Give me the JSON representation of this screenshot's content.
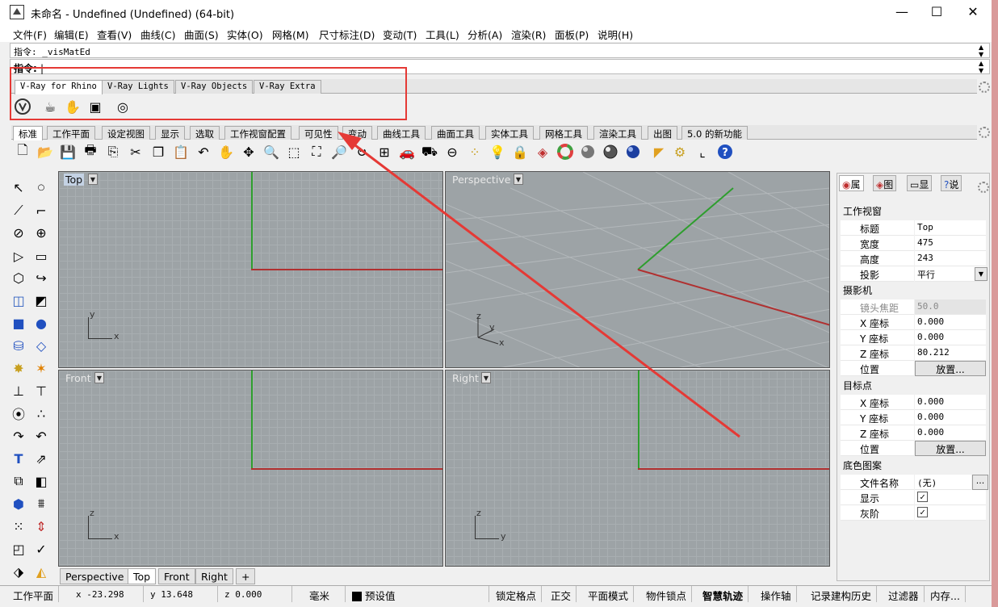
{
  "window": {
    "title": "未命名 - Undefined (Undefined) (64-bit)",
    "minimize": "—",
    "maximize": "☐",
    "close": "✕"
  },
  "menu": [
    "文件(F)",
    "编辑(E)",
    "查看(V)",
    "曲线(C)",
    "曲面(S)",
    "实体(O)",
    "网格(M)",
    "尺寸标注(D)",
    "变动(T)",
    "工具(L)",
    "分析(A)",
    "渲染(R)",
    "面板(P)",
    "说明(H)"
  ],
  "command": {
    "history": "指令: _visMatEd",
    "prompt": "指令:",
    "value": ""
  },
  "vray_tabs": [
    "V-Ray for Rhino",
    "V-Ray Lights",
    "V-Ray Objects",
    "V-Ray Extra"
  ],
  "std_tabs": [
    "标准",
    "工作平面",
    "设定视图",
    "显示",
    "选取",
    "工作视窗配置",
    "可见性",
    "变动",
    "曲线工具",
    "曲面工具",
    "实体工具",
    "网格工具",
    "渲染工具",
    "出图",
    "5.0 的新功能"
  ],
  "viewports": [
    {
      "label": "Top",
      "axis": [
        "y",
        "x"
      ]
    },
    {
      "label": "Perspective",
      "axis": [
        "z",
        "y",
        "x"
      ]
    },
    {
      "label": "Front",
      "axis": [
        "z",
        "x"
      ]
    },
    {
      "label": "Right",
      "axis": [
        "z",
        "y"
      ]
    }
  ],
  "panel": {
    "tabs": [
      "属",
      "图",
      "显",
      "说"
    ],
    "viewport_section": "工作视窗",
    "rows1": [
      [
        "标题",
        "Top"
      ],
      [
        "宽度",
        "475"
      ],
      [
        "高度",
        "243"
      ],
      [
        "投影",
        "平行"
      ]
    ],
    "camera_section": "摄影机",
    "rows2": [
      [
        "镜头焦距",
        "50.0"
      ],
      [
        "X 座标",
        "0.000"
      ],
      [
        "Y 座标",
        "0.000"
      ],
      [
        "Z 座标",
        "80.212"
      ],
      [
        "位置",
        "放置..."
      ]
    ],
    "target_section": "目标点",
    "rows3": [
      [
        "X 座标",
        "0.000"
      ],
      [
        "Y 座标",
        "0.000"
      ],
      [
        "Z 座标",
        "0.000"
      ],
      [
        "位置",
        "放置..."
      ]
    ],
    "bg_section": "底色图案",
    "rows4": [
      [
        "文件名称",
        "(无)"
      ],
      [
        "显示",
        ""
      ],
      [
        "灰阶",
        ""
      ]
    ],
    "dots": "..."
  },
  "vp_tabs": [
    "Perspective",
    "Top",
    "Front",
    "Right",
    "+"
  ],
  "status": [
    "工作平面",
    "x -23.298",
    "y 13.648",
    "z 0.000",
    "毫米",
    "预设值",
    "锁定格点",
    "正交",
    "平面模式",
    "物件锁点",
    "智慧轨迹",
    "操作轴",
    "记录建构历史",
    "过滤器",
    "内存..."
  ],
  "colors": {
    "annotation": "#e53935",
    "x_axis": "#b03030",
    "y_axis": "#2e9e2e",
    "viewport_bg": "#9da3a6"
  }
}
